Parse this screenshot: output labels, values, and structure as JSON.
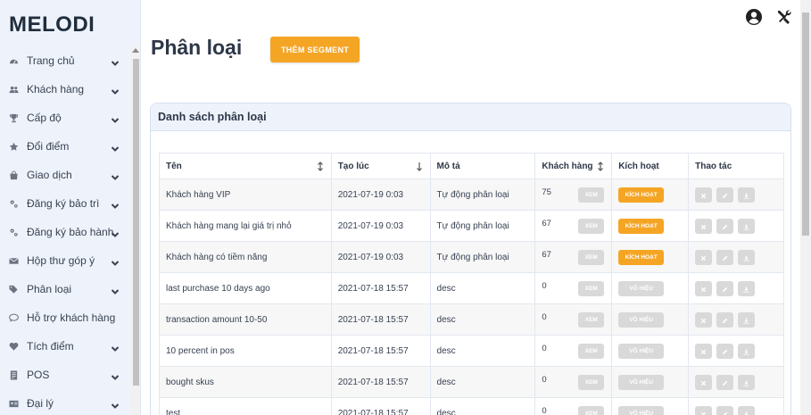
{
  "brand": "MELODI",
  "sidebar": {
    "items": [
      {
        "label": "Trang chủ",
        "icon": "dashboard-icon",
        "has_chevron": true
      },
      {
        "label": "Khách hàng",
        "icon": "users-icon",
        "has_chevron": true
      },
      {
        "label": "Cấp độ",
        "icon": "trophy-icon",
        "has_chevron": true
      },
      {
        "label": "Đổi điểm",
        "icon": "star-icon",
        "has_chevron": true
      },
      {
        "label": "Giao dịch",
        "icon": "shopping-bag-icon",
        "has_chevron": true
      },
      {
        "label": "Đăng ký bảo trì",
        "icon": "gears-icon",
        "has_chevron": true
      },
      {
        "label": "Đăng ký bảo hành",
        "icon": "gears-icon",
        "has_chevron": true
      },
      {
        "label": "Hộp thư góp ý",
        "icon": "envelope-icon",
        "has_chevron": true
      },
      {
        "label": "Phân loại",
        "icon": "tags-icon",
        "has_chevron": true
      },
      {
        "label": "Hỗ trợ khách hàng",
        "icon": "comment-icon",
        "has_chevron": false
      },
      {
        "label": "Tích điểm",
        "icon": "heart-icon",
        "has_chevron": true
      },
      {
        "label": "POS",
        "icon": "document-icon",
        "has_chevron": true
      },
      {
        "label": "Đại lý",
        "icon": "id-card-icon",
        "has_chevron": true
      }
    ]
  },
  "header": {
    "title": "Phân loại",
    "add_button": "THÊM SEGMENT",
    "icons": [
      "user-circle-icon",
      "tools-icon"
    ]
  },
  "card": {
    "title": "Danh sách phân loại"
  },
  "table": {
    "columns": [
      "Tên",
      "Tạo lúc",
      "Mô tả",
      "Khách hàng",
      "Kích hoạt",
      "Thao tác"
    ],
    "view_label": "XEM",
    "rows": [
      {
        "name": "Khách hàng VIP",
        "created": "2021-07-19 0:03",
        "desc": "Tự động phân loại",
        "customers": "75",
        "status": "KÍCH HOẠT",
        "active": true
      },
      {
        "name": "Khách hàng mang lại giá trị nhỏ",
        "created": "2021-07-19 0:03",
        "desc": "Tự động phân loại",
        "customers": "67",
        "status": "KÍCH HOẠT",
        "active": true
      },
      {
        "name": "Khách hàng có tiềm năng",
        "created": "2021-07-19 0:03",
        "desc": "Tự động phân loại",
        "customers": "67",
        "status": "KÍCH HOẠT",
        "active": true
      },
      {
        "name": "last purchase 10 days ago",
        "created": "2021-07-18 15:57",
        "desc": "desc",
        "customers": "0",
        "status": "VÔ HIỆU",
        "active": false
      },
      {
        "name": "transaction amount 10-50",
        "created": "2021-07-18 15:57",
        "desc": "desc",
        "customers": "0",
        "status": "VÔ HIỆU",
        "active": false
      },
      {
        "name": "10 percent in pos",
        "created": "2021-07-18 15:57",
        "desc": "desc",
        "customers": "0",
        "status": "VÔ HIỆU",
        "active": false
      },
      {
        "name": "bought skus",
        "created": "2021-07-18 15:57",
        "desc": "desc",
        "customers": "0",
        "status": "VÔ HIỆU",
        "active": false
      },
      {
        "name": "test",
        "created": "2021-07-18 15:57",
        "desc": "desc",
        "customers": "0",
        "status": "VÔ HIỆU",
        "active": false
      }
    ]
  },
  "colors": {
    "accent": "#f5a524",
    "disabled": "#d9d9d9",
    "sidebar_bg": "#eef3fb"
  }
}
